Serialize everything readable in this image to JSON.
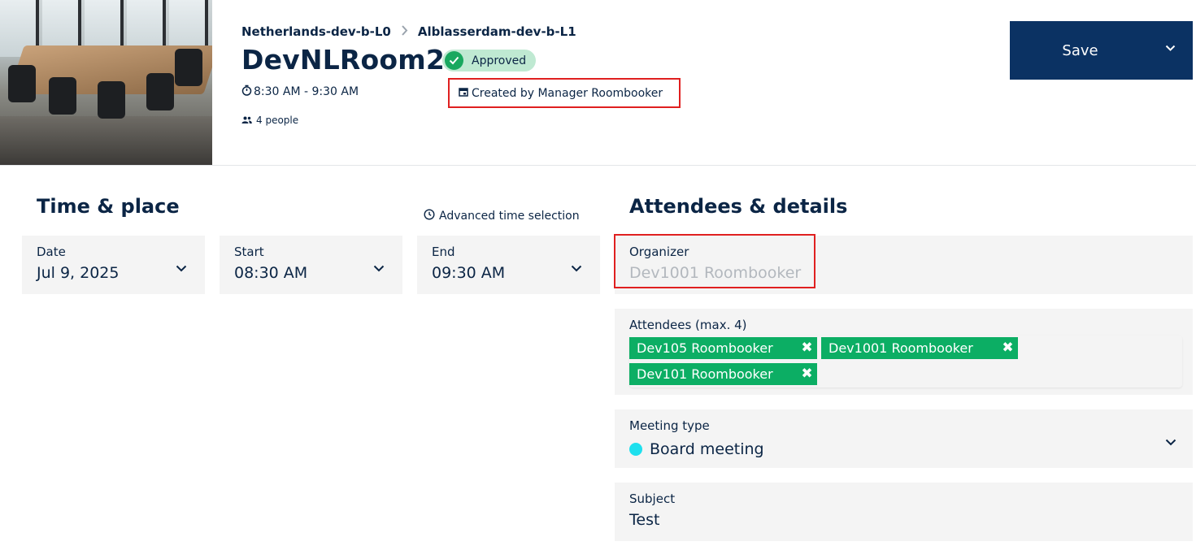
{
  "header": {
    "breadcrumb": [
      "Netherlands-dev-b-L0",
      "Alblasserdam-dev-b-L1"
    ],
    "room_name": "DevNLRoom2",
    "status": "Approved",
    "time_range": "8:30 AM - 9:30 AM",
    "created_by": "Created by Manager Roombooker",
    "capacity": "4 people",
    "save_label": "Save"
  },
  "time_place": {
    "title": "Time & place",
    "advanced_label": "Advanced time selection",
    "date": {
      "label": "Date",
      "value": "Jul 9, 2025"
    },
    "start": {
      "label": "Start",
      "value": "08:30 AM"
    },
    "end": {
      "label": "End",
      "value": "09:30 AM"
    }
  },
  "details": {
    "title": "Attendees & details",
    "organizer": {
      "label": "Organizer",
      "value": "Dev1001 Roombooker"
    },
    "attendees": {
      "label": "Attendees (max. 4)",
      "items": [
        "Dev105 Roombooker",
        "Dev1001 Roombooker",
        "Dev101 Roombooker"
      ]
    },
    "meeting_type": {
      "label": "Meeting type",
      "value": "Board meeting",
      "color": "#1ee0ee"
    },
    "subject": {
      "label": "Subject",
      "value": "Test"
    }
  },
  "colors": {
    "primary": "#0b3263",
    "chip": "#0cae64",
    "status_bg": "#bfe9d2",
    "highlight": "#e02020"
  }
}
